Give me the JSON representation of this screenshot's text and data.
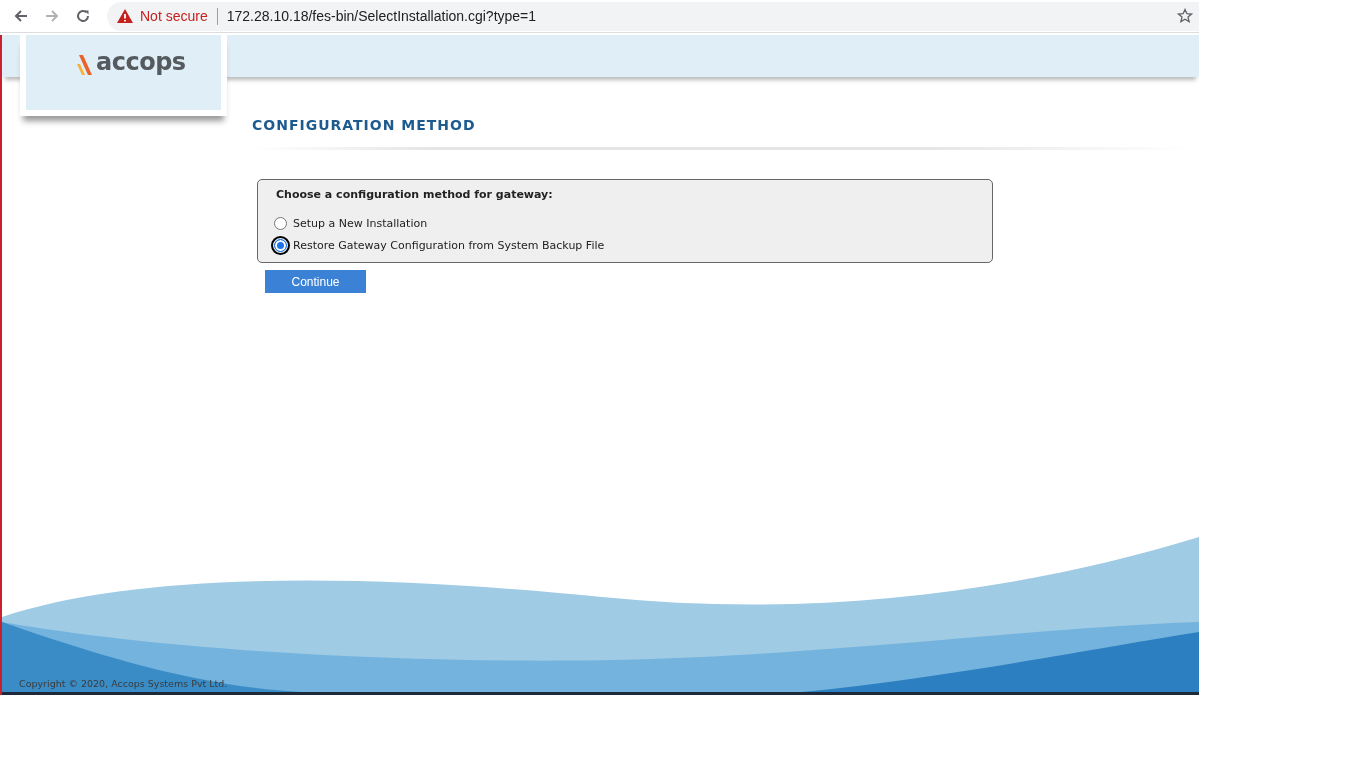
{
  "browser": {
    "security_label": "Not secure",
    "url": "172.28.10.18/fes-bin/SelectInstallation.cgi?type=1"
  },
  "header": {
    "logo_text": "accops"
  },
  "page_title": "CONFIGURATION METHOD",
  "form": {
    "prompt": "Choose a configuration method for gateway:",
    "options": [
      {
        "label": "Setup a New Installation",
        "selected": false
      },
      {
        "label": "Restore Gateway Configuration from System Backup File",
        "selected": true
      }
    ],
    "button": "Continue"
  },
  "footer": {
    "copyright": "Copyright © 2020, Accops Systems Pvt Ltd."
  }
}
